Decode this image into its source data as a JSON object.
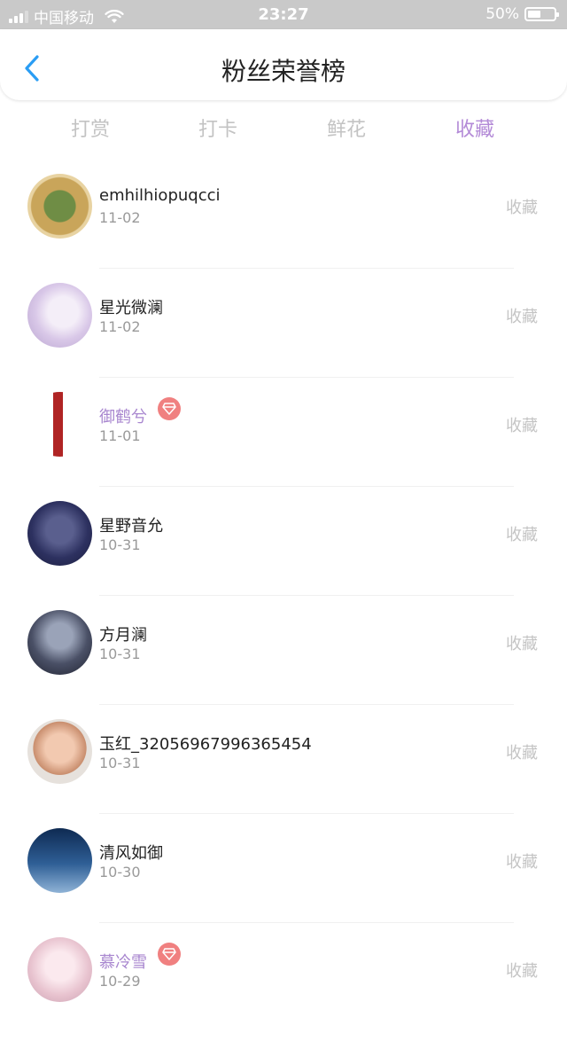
{
  "status_bar": {
    "carrier": "中国移动",
    "time": "23:27",
    "battery": "50%",
    "battery_level": 0.5
  },
  "nav": {
    "title": "粉丝荣誉榜"
  },
  "tabs": [
    {
      "label": "打赏",
      "active": false
    },
    {
      "label": "打卡",
      "active": false
    },
    {
      "label": "鲜花",
      "active": false
    },
    {
      "label": "收藏",
      "active": true
    }
  ],
  "colors": {
    "accent": "#b38ad7",
    "vip_name": "#a886cf",
    "badge": "#f08080"
  },
  "fans": [
    {
      "name": "emhilhiopuqcci",
      "date": "11-02",
      "action": "收藏",
      "vip": false
    },
    {
      "name": "星光微澜",
      "date": "11-02",
      "action": "收藏",
      "vip": false
    },
    {
      "name": "御鹤兮",
      "date": "11-01",
      "action": "收藏",
      "vip": true
    },
    {
      "name": "星野音允",
      "date": "10-31",
      "action": "收藏",
      "vip": false
    },
    {
      "name": "方月澜",
      "date": "10-31",
      "action": "收藏",
      "vip": false
    },
    {
      "name": "玉红_32056967996365454",
      "date": "10-31",
      "action": "收藏",
      "vip": false
    },
    {
      "name": "清风如御",
      "date": "10-30",
      "action": "收藏",
      "vip": false
    },
    {
      "name": "慕冷雪",
      "date": "10-29",
      "action": "收藏",
      "vip": true
    }
  ]
}
